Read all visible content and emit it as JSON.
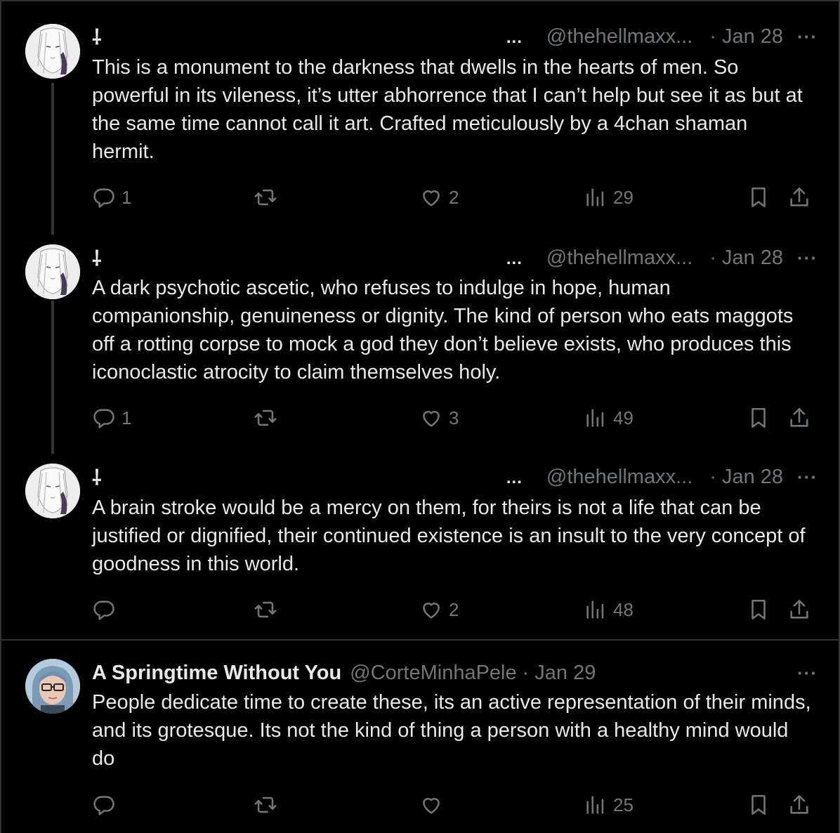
{
  "tweets": [
    {
      "name": "⸸",
      "ellipsis": "...",
      "handle": "@thehellmaxx...",
      "dot": "·",
      "date": "Jan 28",
      "more": "···",
      "text": "This is a monument to the darkness that dwells in the hearts of men. So powerful in its vileness, it’s utter abhorrence that I can’t help but see it as but at the same time cannot call it art. Crafted meticulously by a 4chan shaman hermit.",
      "replies": "1",
      "retweets": "",
      "likes": "2",
      "views": "29"
    },
    {
      "name": "⸸",
      "ellipsis": "...",
      "handle": "@thehellmaxx...",
      "dot": "·",
      "date": "Jan 28",
      "more": "···",
      "text": "A dark psychotic ascetic, who refuses to indulge in hope, human companionship, genuineness or dignity. The kind of person who eats maggots off a rotting corpse to mock a god they don’t believe exists, who produces this iconoclastic atrocity to claim themselves holy.",
      "replies": "1",
      "retweets": "",
      "likes": "3",
      "views": "49"
    },
    {
      "name": "⸸",
      "ellipsis": "...",
      "handle": "@thehellmaxx...",
      "dot": "·",
      "date": "Jan 28",
      "more": "···",
      "text": "A brain stroke would be a mercy on them, for theirs is not a life that can be justified or dignified, their continued existence is an insult to the very concept of goodness in this world.",
      "replies": "",
      "retweets": "",
      "likes": "2",
      "views": "48"
    },
    {
      "name": "A Springtime Without You",
      "handle": "@CorteMinhaPele",
      "dot": "·",
      "date": "Jan 29",
      "more": "···",
      "text": "People dedicate time to create these, its an active representation of their minds, and its grotesque. Its not the kind of thing a person with a healthy mind would do",
      "replies": "",
      "retweets": "",
      "likes": "",
      "views": "25"
    }
  ],
  "icons": {
    "reply": "reply-icon",
    "retweet": "retweet-icon",
    "like": "heart-icon",
    "views": "views-icon",
    "bookmark": "bookmark-icon",
    "share": "share-icon"
  },
  "colors": {
    "background": "#000000",
    "text": "#e7e9ea",
    "muted": "#71767b",
    "border": "#2f3336"
  }
}
